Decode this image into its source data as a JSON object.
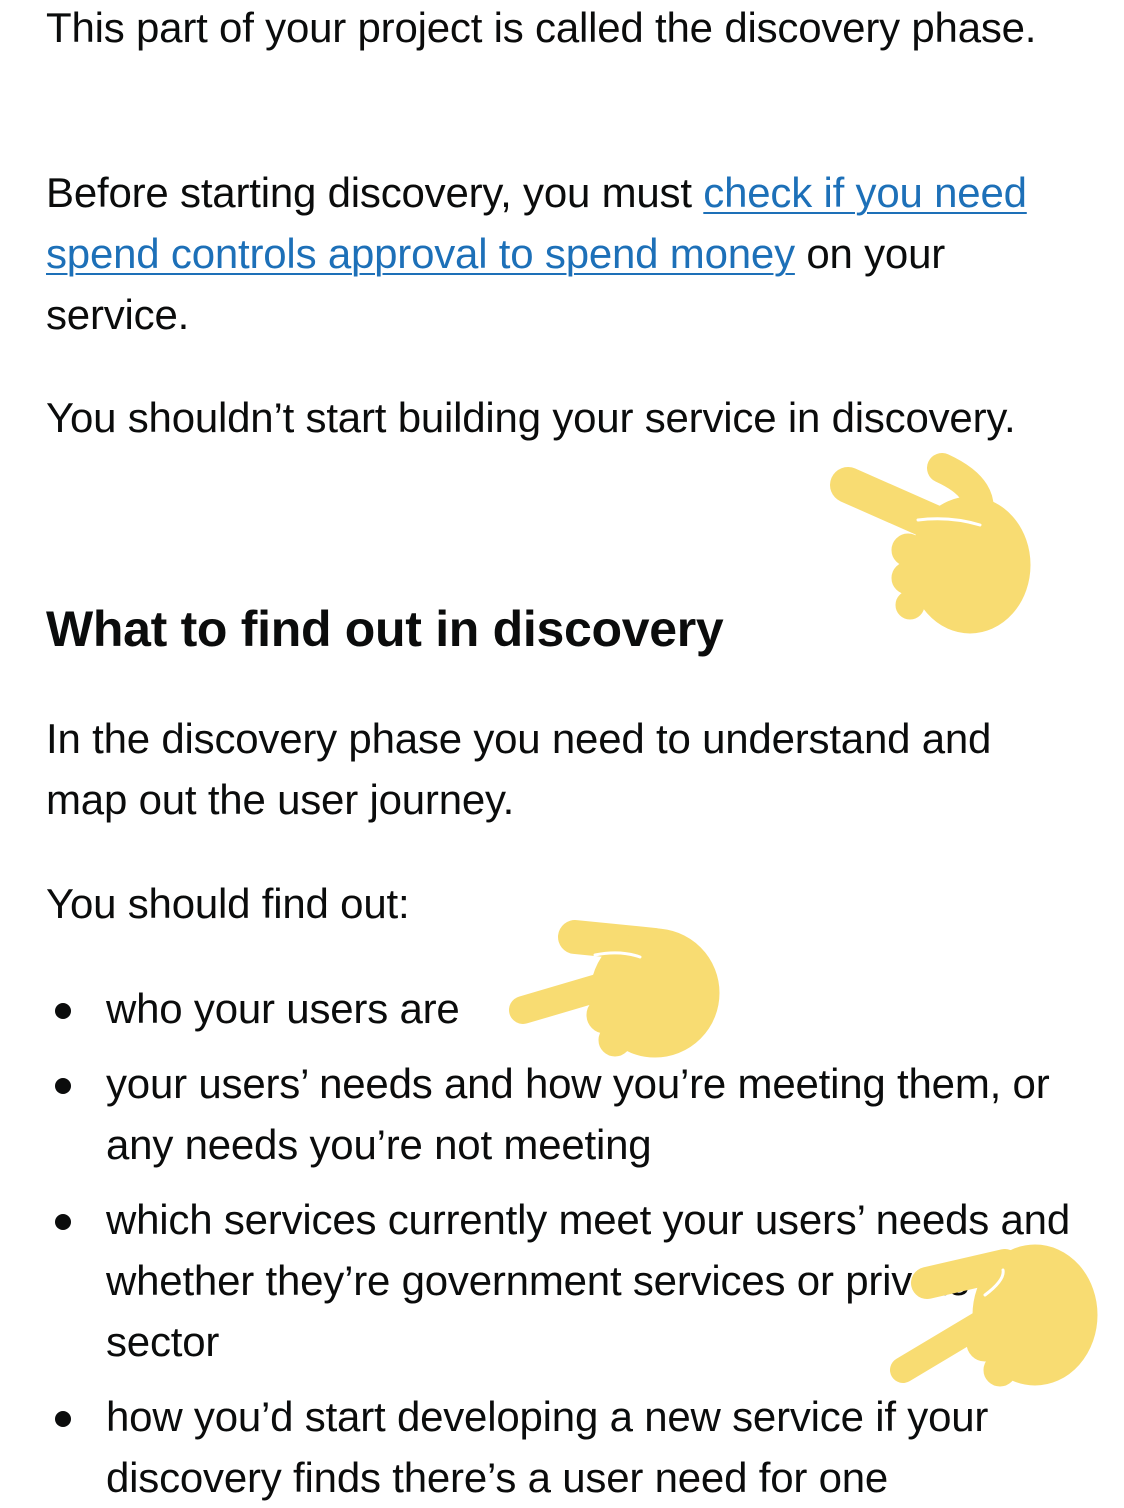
{
  "intro": {
    "para1": "This part of your project is called the discovery phase.",
    "para2_before": "Before starting discovery, you must ",
    "para2_link": "check if you need spend controls approval to spend money",
    "para2_after": " on your service.",
    "para3": "You shouldn’t start building your service in discovery."
  },
  "section": {
    "heading": "What to find out in discovery",
    "para1": "In the discovery phase you need to understand and map out the user journey.",
    "para2": "You should find out:",
    "items": [
      "who your users are",
      "your users’ needs and how you’re meeting them, or any needs you’re not meeting",
      "which services currently meet your users’ needs and whether they’re government services or private sector",
      "how you’d start developing a new service if your discovery finds there’s a user need for one"
    ]
  },
  "colors": {
    "text": "#0b0c0c",
    "link": "#1d70b8",
    "emoji_hand": "#f8dc72"
  },
  "icons": [
    "pointing-hand-icon",
    "pointing-hand-icon",
    "pointing-hand-icon"
  ]
}
